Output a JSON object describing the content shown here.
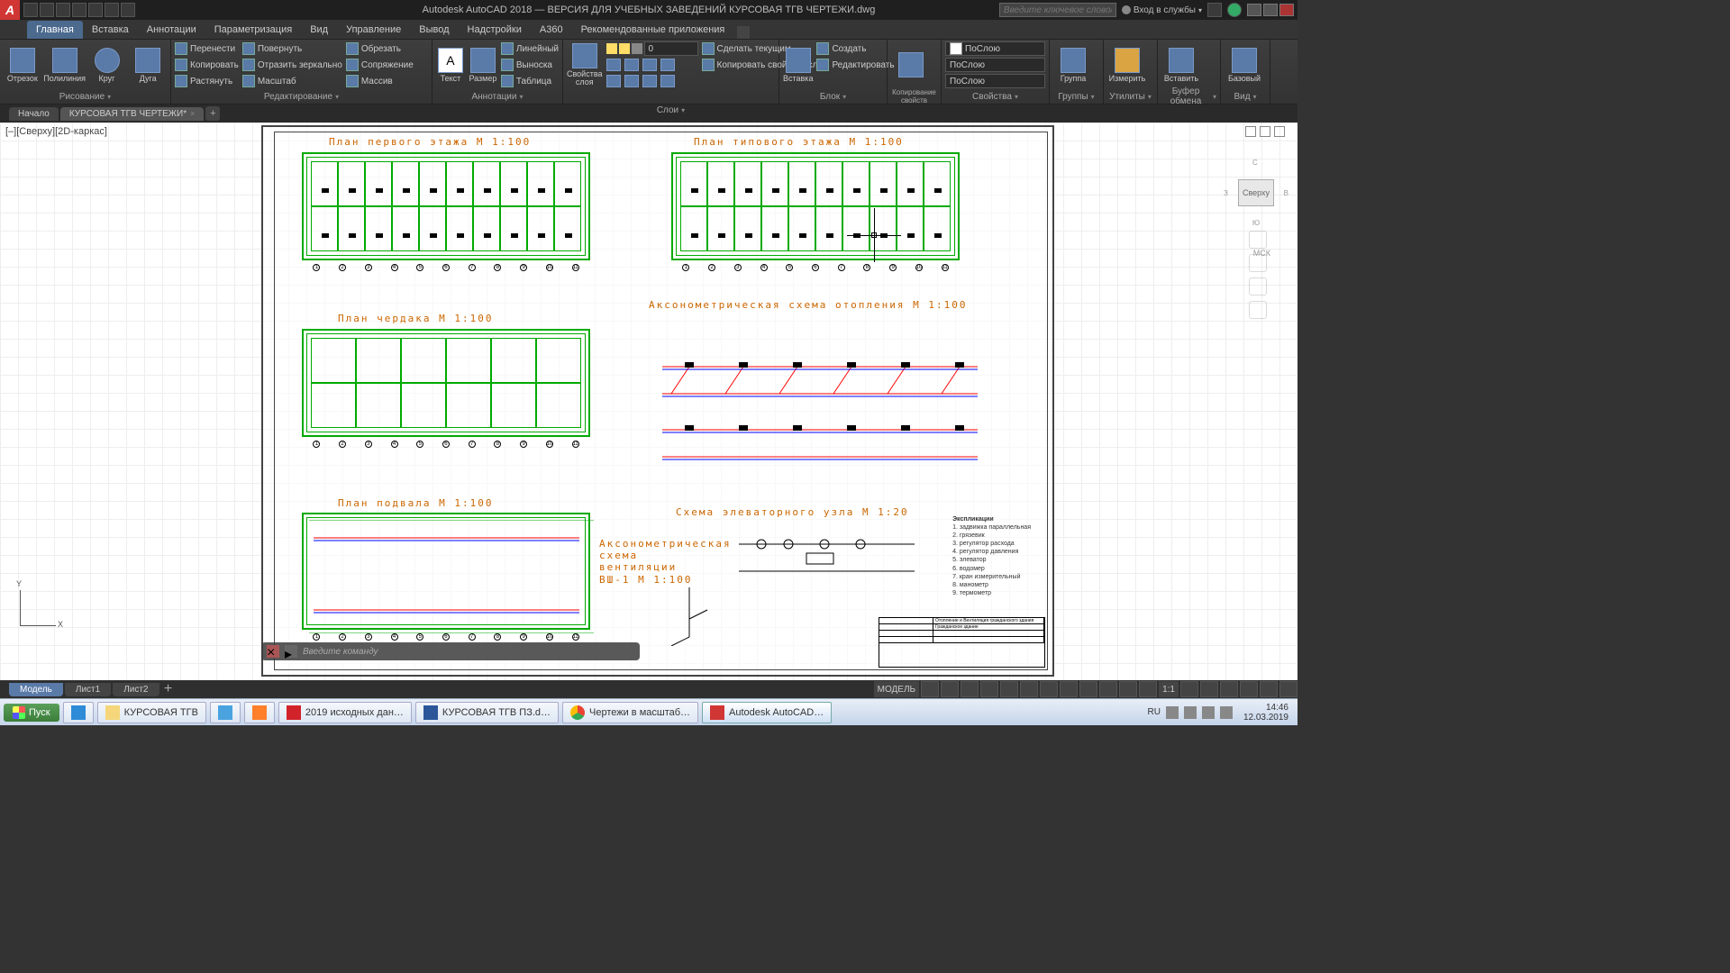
{
  "titlebar": {
    "app_icon": "A",
    "title": "Autodesk AutoCAD 2018 — ВЕРСИЯ ДЛЯ УЧЕБНЫХ ЗАВЕДЕНИЙ    КУРСОВАЯ ТГВ ЧЕРТЕЖИ.dwg",
    "search_placeholder": "Введите ключевое слово/фразу",
    "login": "Вход в службы"
  },
  "ribbon_tabs": [
    "Главная",
    "Вставка",
    "Аннотации",
    "Параметризация",
    "Вид",
    "Управление",
    "Вывод",
    "Надстройки",
    "A360",
    "Рекомендованные приложения"
  ],
  "ribbon_active": 0,
  "panels": {
    "draw": {
      "title": "Рисование",
      "big": [
        "Отрезок",
        "Полилиния",
        "Круг",
        "Дуга"
      ]
    },
    "modify": {
      "title": "Редактирование",
      "rows": [
        [
          "Перенести",
          "Повернуть",
          "Обрезать"
        ],
        [
          "Копировать",
          "Отразить зеркально",
          "Сопряжение"
        ],
        [
          "Растянуть",
          "Масштаб",
          "Массив"
        ]
      ]
    },
    "annot": {
      "title": "Аннотации",
      "big": [
        "Текст",
        "Размер"
      ],
      "rows": [
        [
          "Линейный"
        ],
        [
          "Выноска"
        ],
        [
          "Таблица"
        ]
      ]
    },
    "layers": {
      "title": "Слои",
      "big": "Свойства слоя",
      "combo": "0",
      "rows": [
        [
          "Сделать текущим"
        ],
        [
          "Копировать свойства слоя"
        ]
      ]
    },
    "block": {
      "title": "Блок",
      "big": "Вставка",
      "rows": [
        [
          "Создать"
        ],
        [
          "Редактировать"
        ]
      ]
    },
    "propcopy": {
      "title": "Копирование свойств"
    },
    "props": {
      "title": "Свойства",
      "combos": [
        "ПоСлою",
        "ПоСлою",
        "ПоСлою"
      ]
    },
    "groups": {
      "title": "Группы",
      "big": "Группа"
    },
    "utils": {
      "title": "Утилиты",
      "big": "Измерить"
    },
    "clip": {
      "title": "Буфер обмена",
      "big": "Вставить"
    },
    "view": {
      "title": "Вид",
      "big": "Базовый"
    }
  },
  "doc_tabs": [
    "Начало",
    "КУРСОВАЯ ТГВ ЧЕРТЕЖИ*"
  ],
  "doc_active": 1,
  "view_label": "[–][Сверху][2D-каркас]",
  "viewcube": {
    "face": "Сверху",
    "n": "С",
    "s": "Ю",
    "e": "В",
    "w": "З",
    "wcs": "МСК"
  },
  "drawings": {
    "t1": "План первого этажа М 1:100",
    "t2": "План типового этажа М 1:100",
    "t3": "План чердака М 1:100",
    "t4": "Аксонометрическая схема      отопления М 1:100",
    "t5": "План подвала М 1:100",
    "t6": "Схема элеваторного узла М 1:20",
    "t7": "Аксонометрическая схема вентиляции ВШ-1 М 1:100",
    "expl_title": "Экспликации",
    "expl": [
      "1. задвижка параллельная",
      "2. грязевик",
      "3. регулятор расхода",
      "4. регулятор давления",
      "5. элеватор",
      "6. водомер",
      "7. кран измерительный",
      "8. манометр",
      "9. термометр"
    ],
    "title_block": {
      "proj": "Отопление и Вентиляция гражданского здания",
      "obj": "Гражданское здание"
    }
  },
  "cmd_prompt": "Введите команду",
  "layout_tabs": [
    "Модель",
    "Лист1",
    "Лист2"
  ],
  "layout_active": 0,
  "statusbar": {
    "model": "МОДЕЛЬ",
    "scale": "1:1"
  },
  "taskbar": {
    "start": "Пуск",
    "items": [
      {
        "label": "КУРСОВАЯ ТГВ",
        "icon": "#f5d67a"
      },
      {
        "label": "",
        "icon": "#4aa3df"
      },
      {
        "label": "",
        "icon": "#ff7f2a"
      },
      {
        "label": "2019 исходных дан…",
        "icon": "#d2232a"
      },
      {
        "label": "КУРСОВАЯ ТГВ ПЗ.d…",
        "icon": "#2b579a"
      },
      {
        "label": "Чертежи в масштаб…",
        "icon": "#4c8bf5"
      },
      {
        "label": "Autodesk AutoCAD…",
        "icon": "#d03634",
        "active": true
      }
    ],
    "lang": "RU",
    "time": "14:46",
    "date": "12.03.2019"
  }
}
